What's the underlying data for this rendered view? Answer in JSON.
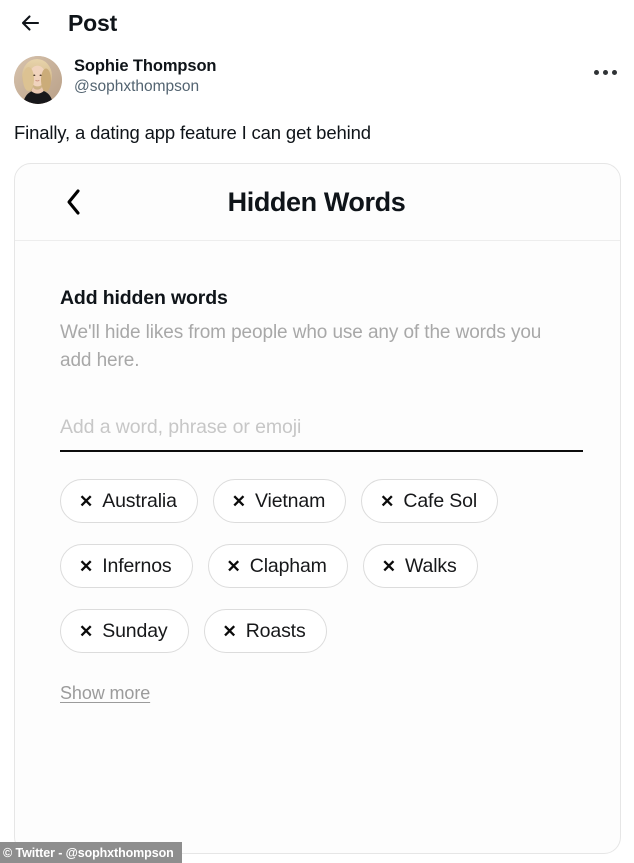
{
  "topbar": {
    "back_icon": "arrow-left-icon",
    "title": "Post"
  },
  "author": {
    "display_name": "Sophie Thompson",
    "handle": "@sophxthompson",
    "avatar_alt": "avatar",
    "more_icon": "more-horizontal-icon"
  },
  "tweet": {
    "text": "Finally, a dating app feature I can get behind"
  },
  "card": {
    "back_icon": "chevron-left-icon",
    "title": "Hidden Words",
    "section_title": "Add hidden words",
    "section_description": "We'll hide likes from people who use any of the words you add here.",
    "input": {
      "placeholder": "Add a word, phrase or emoji",
      "value": ""
    },
    "chip_remove_icon": "close-x-icon",
    "chips": [
      {
        "label": "Australia"
      },
      {
        "label": "Vietnam"
      },
      {
        "label": "Cafe Sol"
      },
      {
        "label": "Infernos"
      },
      {
        "label": "Clapham"
      },
      {
        "label": "Walks"
      },
      {
        "label": "Sunday"
      },
      {
        "label": "Roasts"
      }
    ],
    "show_more_label": "Show more"
  },
  "watermark": {
    "text": "© Twitter - @sophxthompson"
  },
  "colors": {
    "text_primary": "#0f1419",
    "text_secondary": "#536471",
    "text_muted": "#a8a8a8",
    "placeholder": "#c7c7c7",
    "chip_border": "#dcdcdc",
    "card_border": "#e6e6e6",
    "underline": "#0d0d0d",
    "watermark_bg": "#8e8e8e"
  }
}
